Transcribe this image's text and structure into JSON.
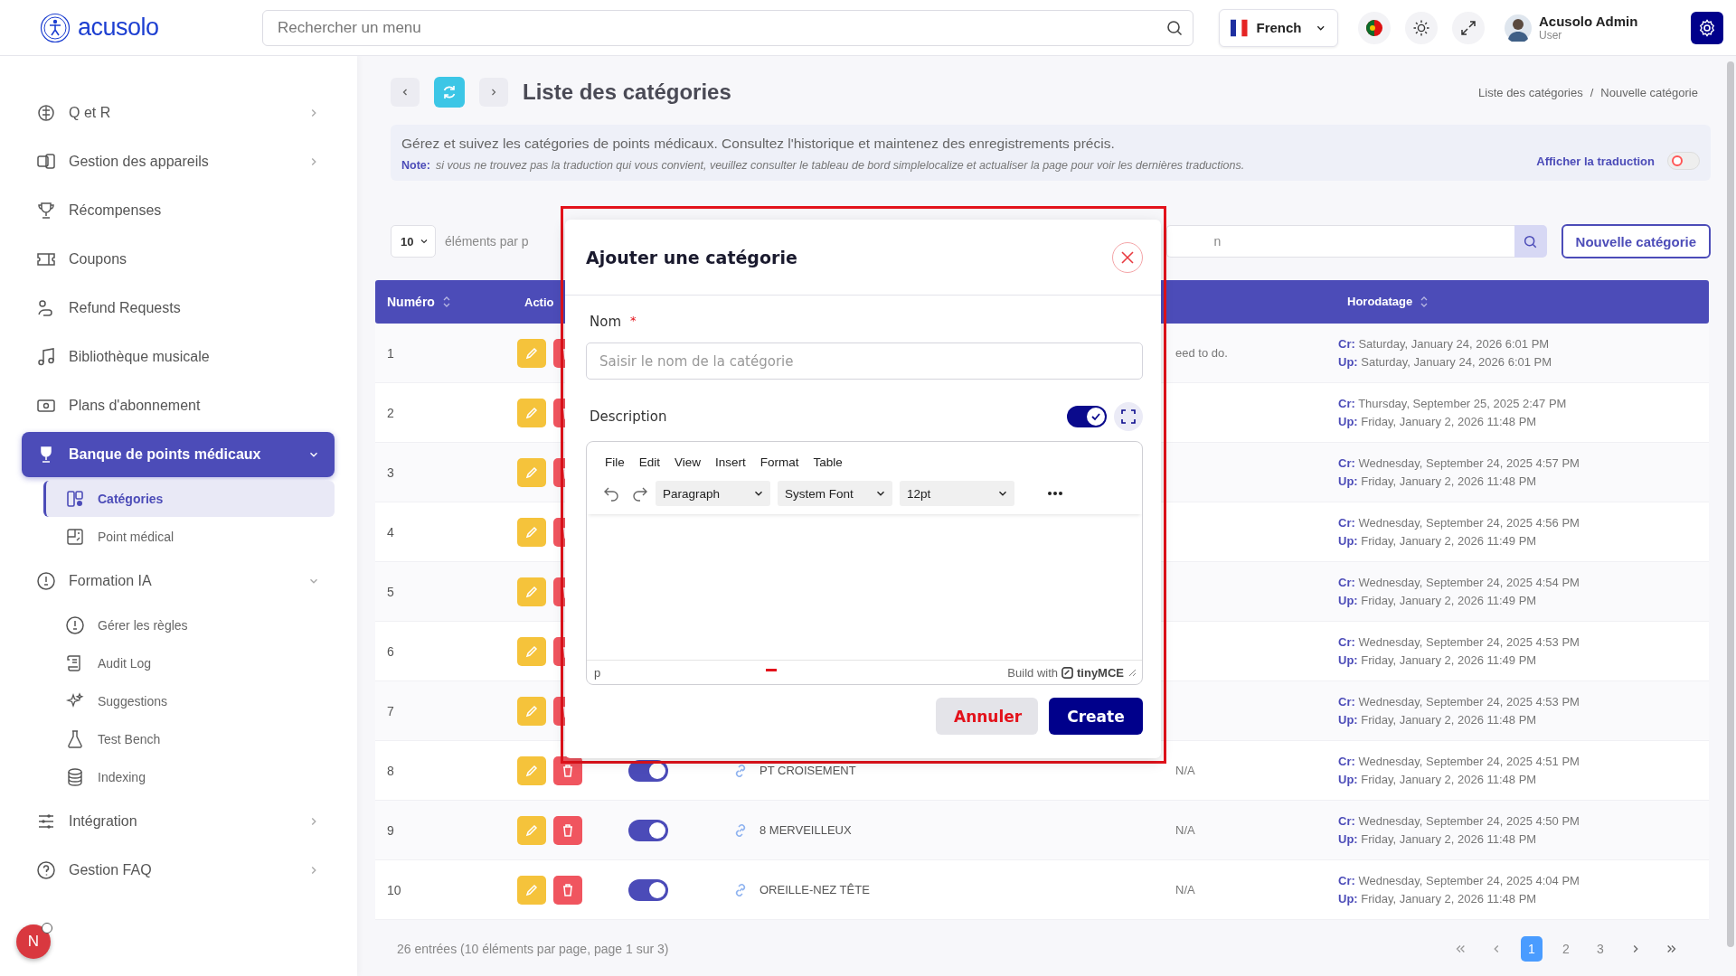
{
  "topbar": {
    "logo": "acusolo",
    "search": {
      "placeholder": "Rechercher un menu"
    },
    "language": "French",
    "user": {
      "name": "Acusolo Admin",
      "role": "User"
    }
  },
  "sidebar": {
    "items": [
      {
        "label": "Q et R",
        "kind": "group",
        "expanded": false,
        "selected": false
      },
      {
        "label": "Gestion des appareils",
        "kind": "group",
        "expanded": false,
        "selected": false
      },
      {
        "label": "Récompenses",
        "kind": "link",
        "selected": false
      },
      {
        "label": "Coupons",
        "kind": "link",
        "selected": false
      },
      {
        "label": "Refund Requests",
        "kind": "link",
        "selected": false
      },
      {
        "label": "Bibliothèque musicale",
        "kind": "link",
        "selected": false
      },
      {
        "label": "Plans d'abonnement",
        "kind": "link",
        "selected": false
      },
      {
        "label": "Banque de points médicaux",
        "kind": "group",
        "expanded": true,
        "selected": true,
        "children": [
          {
            "label": "Catégories",
            "selected": true
          },
          {
            "label": "Point médical",
            "selected": false
          }
        ]
      },
      {
        "label": "Formation IA",
        "kind": "group",
        "expanded": true,
        "selected": false,
        "children": [
          {
            "label": "Gérer les règles",
            "selected": false
          },
          {
            "label": "Audit Log",
            "selected": false
          },
          {
            "label": "Suggestions",
            "selected": false
          },
          {
            "label": "Test Bench",
            "selected": false
          },
          {
            "label": "Indexing",
            "selected": false
          }
        ]
      },
      {
        "label": "Intégration",
        "kind": "group",
        "expanded": false,
        "selected": false
      },
      {
        "label": "Gestion FAQ",
        "kind": "group",
        "expanded": false,
        "selected": false
      }
    ]
  },
  "notification_badge": "N",
  "page": {
    "title": "Liste des catégories",
    "breadcrumb": [
      "Liste des catégories",
      "Nouvelle catégorie"
    ],
    "breadcrumb_separator": "/",
    "description": "Gérez et suivez les catégories de points médicaux. Consultez l'historique et maintenez des enregistrements précis.",
    "note_label": "Note:",
    "note": "si vous ne trouvez pas la traduction qui vous convient, veuillez consulter le tableau de bord simplelocalize et actualiser la page pour voir les dernières traductions.",
    "translation_toggle": {
      "label": "Afficher la traduction",
      "on": false
    }
  },
  "toolbar": {
    "page_size": "10",
    "page_size_label": "éléments par p",
    "search_placeholder": "n",
    "new_button": "Nouvelle catégorie"
  },
  "table": {
    "columns": [
      "Numéro",
      "Actio",
      "Horodatage"
    ],
    "rows": [
      {
        "number": "1",
        "description": "eed to do.",
        "created_label": "Cr:",
        "created": "Saturday, January 24, 2026 6:01 PM",
        "updated_label": "Up:",
        "updated": "Saturday, January 24, 2026 6:01 PM"
      },
      {
        "number": "2",
        "created_label": "Cr:",
        "created": "Thursday, September 25, 2025 2:47 PM",
        "updated_label": "Up:",
        "updated": "Friday, January 2, 2026 11:48 PM"
      },
      {
        "number": "3",
        "created_label": "Cr:",
        "created": "Wednesday, September 24, 2025 4:57 PM",
        "updated_label": "Up:",
        "updated": "Friday, January 2, 2026 11:48 PM"
      },
      {
        "number": "4",
        "created_label": "Cr:",
        "created": "Wednesday, September 24, 2025 4:56 PM",
        "updated_label": "Up:",
        "updated": "Friday, January 2, 2026 11:49 PM"
      },
      {
        "number": "5",
        "created_label": "Cr:",
        "created": "Wednesday, September 24, 2025 4:54 PM",
        "updated_label": "Up:",
        "updated": "Friday, January 2, 2026 11:49 PM"
      },
      {
        "number": "6",
        "created_label": "Cr:",
        "created": "Wednesday, September 24, 2025 4:53 PM",
        "updated_label": "Up:",
        "updated": "Friday, January 2, 2026 11:49 PM"
      },
      {
        "number": "7",
        "created_label": "Cr:",
        "created": "Wednesday, September 24, 2025 4:53 PM",
        "updated_label": "Up:",
        "updated": "Friday, January 2, 2026 11:48 PM"
      },
      {
        "number": "8",
        "active": true,
        "name": "PT CROISEMENT",
        "description": "N/A",
        "created_label": "Cr:",
        "created": "Wednesday, September 24, 2025 4:51 PM",
        "updated_label": "Up:",
        "updated": "Friday, January 2, 2026 11:48 PM"
      },
      {
        "number": "9",
        "active": true,
        "name": "8 MERVEILLEUX",
        "description": "N/A",
        "created_label": "Cr:",
        "created": "Wednesday, September 24, 2025 4:50 PM",
        "updated_label": "Up:",
        "updated": "Friday, January 2, 2026 11:48 PM"
      },
      {
        "number": "10",
        "active": true,
        "name": "OREILLE-NEZ TÊTE",
        "description": "N/A",
        "created_label": "Cr:",
        "created": "Wednesday, September 24, 2025 4:04 PM",
        "updated_label": "Up:",
        "updated": "Friday, January 2, 2026 11:48 PM"
      }
    ]
  },
  "footer": {
    "summary": "26 entrées (10 éléments par page, page 1 sur 3)",
    "pages": [
      {
        "label": "1",
        "selected": true
      },
      {
        "label": "2",
        "selected": false
      },
      {
        "label": "3",
        "selected": false
      }
    ]
  },
  "dialog": {
    "title": "Ajouter une catégorie",
    "name_label": "Nom",
    "required_mark": "*",
    "name_placeholder": "Saisir le nom de la catégorie",
    "description_label": "Description",
    "editor_toggle": {
      "on": true
    },
    "editor": {
      "menu": [
        "File",
        "Edit",
        "View",
        "Insert",
        "Format",
        "Table"
      ],
      "selects": [
        "Paragraph",
        "System Font",
        "12pt"
      ],
      "status_path": "p",
      "branding_prefix": "Build with",
      "branding": "tinyMCE"
    },
    "buttons": [
      {
        "label": "Annuler",
        "kind": "secondary"
      },
      {
        "label": "Create",
        "kind": "primary"
      }
    ]
  }
}
